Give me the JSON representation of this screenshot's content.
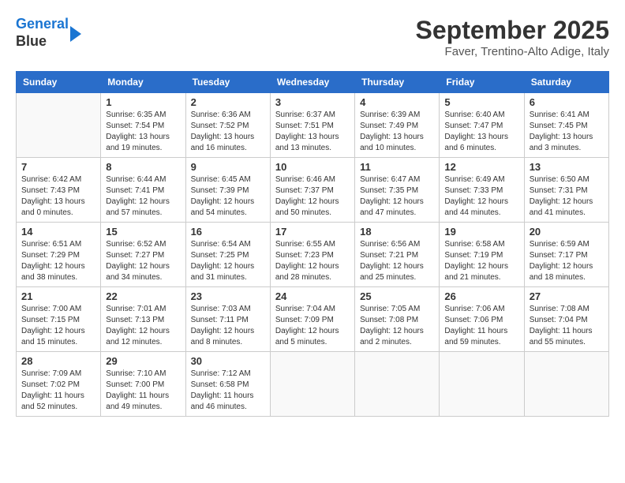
{
  "logo": {
    "line1": "General",
    "line2": "Blue",
    "arrow": true
  },
  "title": "September 2025",
  "location": "Faver, Trentino-Alto Adige, Italy",
  "days_of_week": [
    "Sunday",
    "Monday",
    "Tuesday",
    "Wednesday",
    "Thursday",
    "Friday",
    "Saturday"
  ],
  "weeks": [
    [
      {
        "day": null,
        "info": null
      },
      {
        "day": "1",
        "sunrise": "6:35 AM",
        "sunset": "7:54 PM",
        "daylight": "13 hours and 19 minutes."
      },
      {
        "day": "2",
        "sunrise": "6:36 AM",
        "sunset": "7:52 PM",
        "daylight": "13 hours and 16 minutes."
      },
      {
        "day": "3",
        "sunrise": "6:37 AM",
        "sunset": "7:51 PM",
        "daylight": "13 hours and 13 minutes."
      },
      {
        "day": "4",
        "sunrise": "6:39 AM",
        "sunset": "7:49 PM",
        "daylight": "13 hours and 10 minutes."
      },
      {
        "day": "5",
        "sunrise": "6:40 AM",
        "sunset": "7:47 PM",
        "daylight": "13 hours and 6 minutes."
      },
      {
        "day": "6",
        "sunrise": "6:41 AM",
        "sunset": "7:45 PM",
        "daylight": "13 hours and 3 minutes."
      }
    ],
    [
      {
        "day": "7",
        "sunrise": "6:42 AM",
        "sunset": "7:43 PM",
        "daylight": "13 hours and 0 minutes."
      },
      {
        "day": "8",
        "sunrise": "6:44 AM",
        "sunset": "7:41 PM",
        "daylight": "12 hours and 57 minutes."
      },
      {
        "day": "9",
        "sunrise": "6:45 AM",
        "sunset": "7:39 PM",
        "daylight": "12 hours and 54 minutes."
      },
      {
        "day": "10",
        "sunrise": "6:46 AM",
        "sunset": "7:37 PM",
        "daylight": "12 hours and 50 minutes."
      },
      {
        "day": "11",
        "sunrise": "6:47 AM",
        "sunset": "7:35 PM",
        "daylight": "12 hours and 47 minutes."
      },
      {
        "day": "12",
        "sunrise": "6:49 AM",
        "sunset": "7:33 PM",
        "daylight": "12 hours and 44 minutes."
      },
      {
        "day": "13",
        "sunrise": "6:50 AM",
        "sunset": "7:31 PM",
        "daylight": "12 hours and 41 minutes."
      }
    ],
    [
      {
        "day": "14",
        "sunrise": "6:51 AM",
        "sunset": "7:29 PM",
        "daylight": "12 hours and 38 minutes."
      },
      {
        "day": "15",
        "sunrise": "6:52 AM",
        "sunset": "7:27 PM",
        "daylight": "12 hours and 34 minutes."
      },
      {
        "day": "16",
        "sunrise": "6:54 AM",
        "sunset": "7:25 PM",
        "daylight": "12 hours and 31 minutes."
      },
      {
        "day": "17",
        "sunrise": "6:55 AM",
        "sunset": "7:23 PM",
        "daylight": "12 hours and 28 minutes."
      },
      {
        "day": "18",
        "sunrise": "6:56 AM",
        "sunset": "7:21 PM",
        "daylight": "12 hours and 25 minutes."
      },
      {
        "day": "19",
        "sunrise": "6:58 AM",
        "sunset": "7:19 PM",
        "daylight": "12 hours and 21 minutes."
      },
      {
        "day": "20",
        "sunrise": "6:59 AM",
        "sunset": "7:17 PM",
        "daylight": "12 hours and 18 minutes."
      }
    ],
    [
      {
        "day": "21",
        "sunrise": "7:00 AM",
        "sunset": "7:15 PM",
        "daylight": "12 hours and 15 minutes."
      },
      {
        "day": "22",
        "sunrise": "7:01 AM",
        "sunset": "7:13 PM",
        "daylight": "12 hours and 12 minutes."
      },
      {
        "day": "23",
        "sunrise": "7:03 AM",
        "sunset": "7:11 PM",
        "daylight": "12 hours and 8 minutes."
      },
      {
        "day": "24",
        "sunrise": "7:04 AM",
        "sunset": "7:09 PM",
        "daylight": "12 hours and 5 minutes."
      },
      {
        "day": "25",
        "sunrise": "7:05 AM",
        "sunset": "7:08 PM",
        "daylight": "12 hours and 2 minutes."
      },
      {
        "day": "26",
        "sunrise": "7:06 AM",
        "sunset": "7:06 PM",
        "daylight": "11 hours and 59 minutes."
      },
      {
        "day": "27",
        "sunrise": "7:08 AM",
        "sunset": "7:04 PM",
        "daylight": "11 hours and 55 minutes."
      }
    ],
    [
      {
        "day": "28",
        "sunrise": "7:09 AM",
        "sunset": "7:02 PM",
        "daylight": "11 hours and 52 minutes."
      },
      {
        "day": "29",
        "sunrise": "7:10 AM",
        "sunset": "7:00 PM",
        "daylight": "11 hours and 49 minutes."
      },
      {
        "day": "30",
        "sunrise": "7:12 AM",
        "sunset": "6:58 PM",
        "daylight": "11 hours and 46 minutes."
      },
      {
        "day": null,
        "info": null
      },
      {
        "day": null,
        "info": null
      },
      {
        "day": null,
        "info": null
      },
      {
        "day": null,
        "info": null
      }
    ]
  ]
}
